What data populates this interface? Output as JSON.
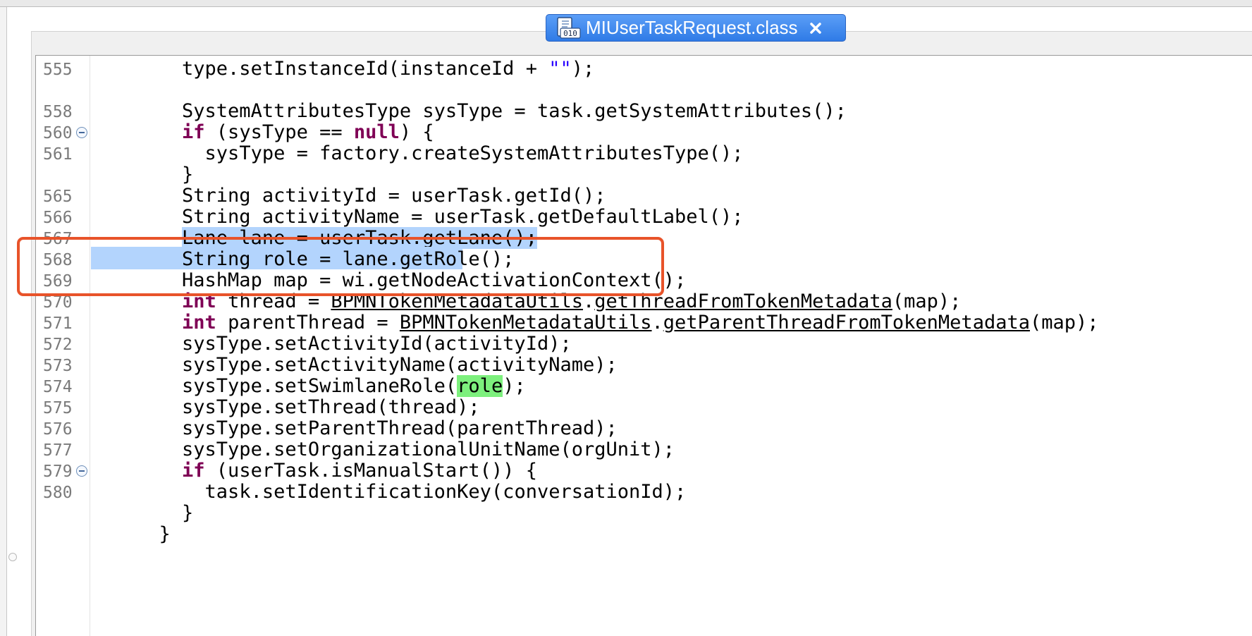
{
  "editor_tab": {
    "title": "MIUserTaskRequest.class",
    "icon": "java-class-file-icon",
    "close_icon": "close-icon",
    "icon_text": "010"
  },
  "colors": {
    "keyword": "#7f0055",
    "string": "#2a00ff",
    "selection": "#b3d4fd",
    "occurrence_highlight": "#7df07d",
    "annotation_box": "#e8532a",
    "tab_active": "#3a86ef"
  },
  "code": {
    "lines": [
      {
        "num": "555",
        "indent": "    ",
        "a": "type.setInstanceId(instanceId + ",
        "str": "\"\"",
        "b": ");"
      },
      {
        "num": "558",
        "indent": "    ",
        "text": "SystemAttributesType sysType = task.getSystemAttributes();"
      },
      {
        "num": "560",
        "indent": "    ",
        "kw": "if",
        "a": " (sysType == ",
        "kw2": "null",
        "b": ") {"
      },
      {
        "num": "561",
        "indent": "      ",
        "text": "sysType = factory.createSystemAttributesType();"
      },
      {
        "num": "",
        "indent": "    ",
        "text": "}"
      },
      {
        "num": "565",
        "indent": "    ",
        "text": "String activityId = userTask.getId();"
      },
      {
        "num": "566",
        "indent": "    ",
        "text": "String activityName = userTask.getDefaultLabel();"
      },
      {
        "num": "567",
        "indent": "    ",
        "text": "Lane lane = userTask.getLane();"
      },
      {
        "num": "568",
        "indent": "    ",
        "text": "String role = lane.getRole();"
      },
      {
        "num": "569",
        "indent": "    ",
        "text": "HashMap map = wi.getNodeActivationContext();"
      },
      {
        "num": "570",
        "indent": "    ",
        "kw": "int",
        "a": " thread = ",
        "cls": "BPMNTokenMetadataUtils",
        "dot": ".",
        "method": "getThreadFromTokenMetadata",
        "b": "(map);"
      },
      {
        "num": "571",
        "indent": "    ",
        "kw": "int",
        "a": " parentThread = ",
        "cls": "BPMNTokenMetadataUtils",
        "dot": ".",
        "method": "getParentThreadFromTokenMetadata",
        "b": "(map);"
      },
      {
        "num": "572",
        "indent": "    ",
        "text": "sysType.setActivityId(activityId);"
      },
      {
        "num": "573",
        "indent": "    ",
        "text": "sysType.setActivityName(activityName);"
      },
      {
        "num": "574",
        "indent": "    ",
        "a": "sysType.setSwimlaneRole(",
        "mark": "role",
        "b": ");"
      },
      {
        "num": "575",
        "indent": "    ",
        "text": "sysType.setThread(thread);"
      },
      {
        "num": "576",
        "indent": "    ",
        "text": "sysType.setParentThread(parentThread);"
      },
      {
        "num": "577",
        "indent": "    ",
        "text": "sysType.setOrganizationalUnitName(orgUnit);"
      },
      {
        "num": "579",
        "indent": "    ",
        "kw": "if",
        "a": " (userTask.isManualStart()) {"
      },
      {
        "num": "580",
        "indent": "      ",
        "text": "task.setIdentificationKey(conversationId);"
      },
      {
        "num": "",
        "indent": "    ",
        "text": "}"
      },
      {
        "num": "",
        "indent": "  ",
        "text": "}"
      }
    ]
  }
}
